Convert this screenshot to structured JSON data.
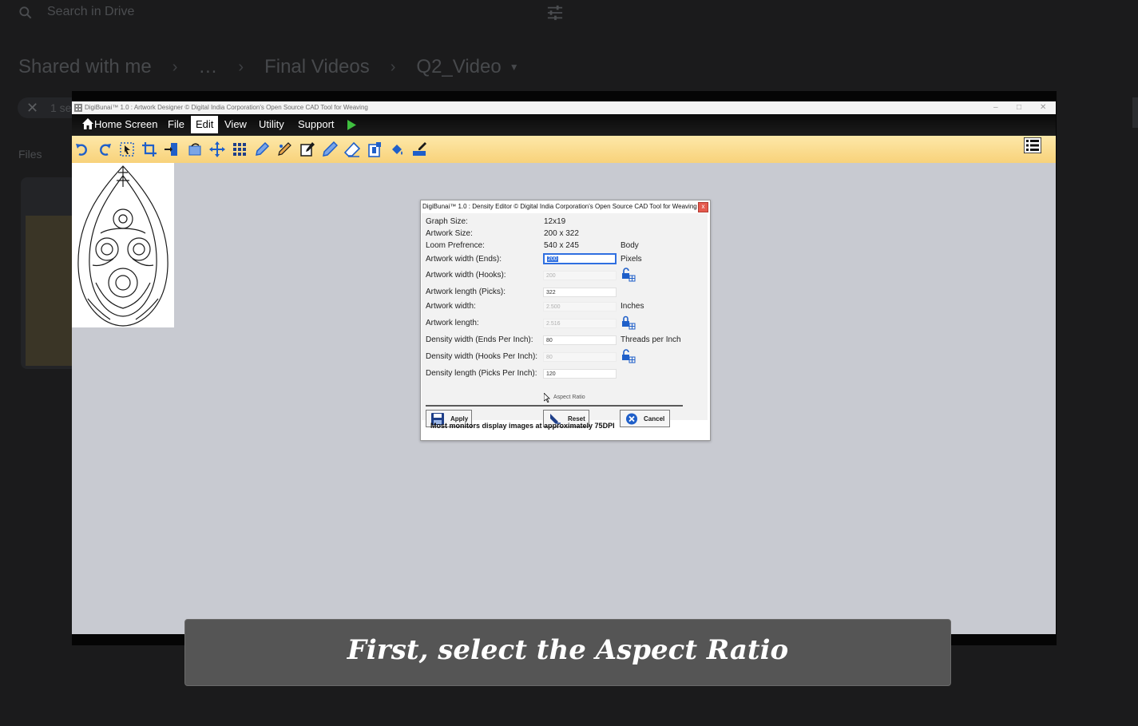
{
  "drive": {
    "search_placeholder": "Search in Drive",
    "breadcrumb": [
      "Shared with me",
      "…",
      "Final Videos",
      "Q2_Video"
    ],
    "selection_text": "1 se",
    "files_label": "Files"
  },
  "app": {
    "window_title": "DigiBunai™ 1.0 : Artwork Designer © Digital India Corporation's Open Source CAD Tool for Weaving",
    "menu": [
      "Home Screen",
      "File",
      "Edit",
      "View",
      "Utility",
      "Support"
    ],
    "active_menu": "Edit",
    "toolbar_icons": [
      "undo-icon",
      "redo-icon",
      "select-icon",
      "crop-icon",
      "resize-icon",
      "rotate-icon",
      "move-icon",
      "grid-icon",
      "color-pick-icon",
      "palette-icon",
      "edit-icon",
      "pencil-icon",
      "eraser-icon",
      "clipboard-icon",
      "fill-icon",
      "brush-icon"
    ]
  },
  "dialog": {
    "title": "DigiBunai™ 1.0 : Density Editor © Digital India Corporation's Open Source CAD Tool for Weaving",
    "close": "x",
    "rows": {
      "graph_size": {
        "label": "Graph Size:",
        "value": "12x19"
      },
      "artwork_size": {
        "label": "Artwork Size:",
        "value": "200 x 322"
      },
      "loom_preference": {
        "label": "Loom Prefrence:",
        "value": "540 x 245",
        "unit": "Body"
      },
      "artwork_width_ends": {
        "label": "Artwork width (Ends):",
        "value": "200",
        "unit": "Pixels"
      },
      "artwork_width_hooks": {
        "label": "Artwork width (Hooks):",
        "value": "200"
      },
      "artwork_length_picks": {
        "label": "Artwork length (Picks):",
        "value": "322"
      },
      "artwork_width": {
        "label": "Artwork width:",
        "value": "2.500",
        "unit": "Inches"
      },
      "artwork_length": {
        "label": "Artwork length:",
        "value": "2.516"
      },
      "density_width_ends": {
        "label": "Density width (Ends Per Inch):",
        "value": "80",
        "unit": "Threads per Inch"
      },
      "density_width_hooks": {
        "label": "Density width (Hooks Per Inch):",
        "value": "80"
      },
      "density_length_picks": {
        "label": "Density length (Picks Per Inch):",
        "value": "120"
      }
    },
    "aspect_ratio": "Aspect Ratio",
    "buttons": {
      "apply": "Apply",
      "reset": "Reset",
      "cancel": "Cancel"
    },
    "footer": "Most monitors display images at approximately 75DPI"
  },
  "caption": "First, select the Aspect Ratio"
}
